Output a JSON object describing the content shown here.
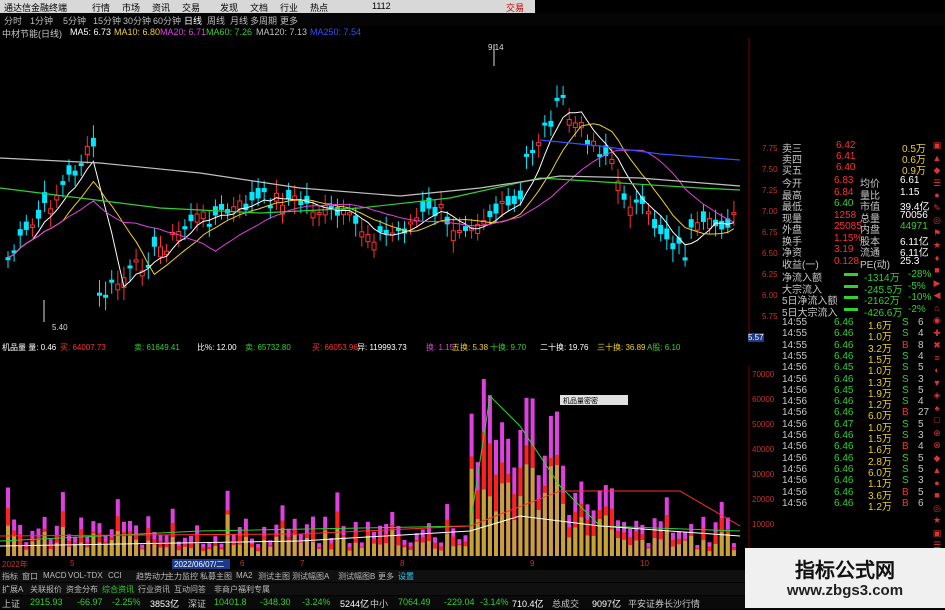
{
  "menubar": {
    "app_title": "通达信金融终端",
    "items": [
      "行情",
      "市场",
      "资讯",
      "交易",
      "发现",
      "文档",
      "行业",
      "热点",
      "1112"
    ],
    "trade_button": "交易"
  },
  "period_tabs": [
    "分时",
    "1分钟",
    "5分钟",
    "15分钟",
    "30分钟",
    "60分钟",
    "日线",
    "周线",
    "月线",
    "多周期",
    "更多"
  ],
  "active_period": "日线",
  "ma_legend": {
    "name": "中材节能(日线)",
    "items": [
      {
        "label": "MA5: 6.73",
        "color": "#ffffff"
      },
      {
        "label": "MA10: 6.80",
        "color": "#f0d020"
      },
      {
        "label": "MA20: 6.71",
        "color": "#e040e0"
      },
      {
        "label": "MA60: 7.26",
        "color": "#30d030"
      },
      {
        "label": "MA120: 7.13",
        "color": "#c0c0c0"
      },
      {
        "label": "MA250: 7.54",
        "color": "#3050ff"
      }
    ]
  },
  "price_axis": [
    "7.75",
    "7.50",
    "7.25",
    "7.00",
    "6.75",
    "6.50",
    "6.25",
    "6.00",
    "5.75",
    "5.57"
  ],
  "price_axis_highlight": "5.57",
  "annotations": {
    "high": "9.14",
    "low": "5.40"
  },
  "vol_legend": {
    "items": [
      {
        "label": "机品量 量: 0.46",
        "color": "#ffffff"
      },
      {
        "label": "买: 64007.73",
        "color": "#ff3030"
      },
      {
        "label": "卖: 61649.41",
        "color": "#30d030"
      },
      {
        "label": "比%: 12.00",
        "color": "#ffffff"
      },
      {
        "label": "卖: 65732.80",
        "color": "#30d030"
      },
      {
        "label": "买: 66053.96",
        "color": "#ff3030"
      },
      {
        "label": "异: 119993.73",
        "color": "#ffffff"
      },
      {
        "label": "换: 1.15",
        "color": "#e040e0"
      },
      {
        "label": "五换: 5.38",
        "color": "#f0d020"
      },
      {
        "label": "十换: 9.70",
        "color": "#30d030"
      },
      {
        "label": "二十换: 19.76",
        "color": "#ffffff"
      },
      {
        "label": "三十换: 36.89",
        "color": "#f0d020"
      },
      {
        "label": "A股: 6.10",
        "color": "#30d030"
      }
    ]
  },
  "vol_axis": [
    "70000",
    "60000",
    "50000",
    "40000",
    "30000",
    "20000",
    "10000"
  ],
  "popup_label": "机品量密密",
  "date_box": "2022/06/07/二",
  "year_labels": [
    "2022年",
    "5",
    "6",
    "7",
    "8",
    "9",
    "10"
  ],
  "quote_panel": [
    {
      "k": "卖三",
      "v": "6.42",
      "v2": "0.5万"
    },
    {
      "k": "卖四",
      "v": "6.41",
      "v2": "0.6万"
    },
    {
      "k": "买五",
      "v": "6.40",
      "v2": "0.9万"
    }
  ],
  "stats": [
    {
      "k": "今开",
      "v": "6.83",
      "k2": "均价",
      "v2": "6.61"
    },
    {
      "k": "最高",
      "v": "6.84",
      "k2": "量比",
      "v2": "1.15"
    },
    {
      "k": "最低",
      "v": "6.40",
      "k2": "市值",
      "v2": "39.4亿"
    },
    {
      "k": "现量",
      "v": "1258",
      "k2": "总量",
      "v2": "70056"
    },
    {
      "k": "外盘",
      "v": "25085",
      "k2": "内盘",
      "v2": "44971"
    },
    {
      "k": "换手",
      "v": "1.15%",
      "k2": "股本",
      "v2": "6.11亿"
    },
    {
      "k": "净资",
      "v": "3.19",
      "k2": "流通",
      "v2": "6.11亿"
    },
    {
      "k": "收益(一)",
      "v": "0.128",
      "k2": "PE(动)",
      "v2": "25.3"
    }
  ],
  "flows": [
    {
      "k": "净流入额",
      "v": "-1314万",
      "p": "-28%"
    },
    {
      "k": "大宗流入",
      "v": "-245.5万",
      "p": "-5%"
    },
    {
      "k": "5日净流入额",
      "v": "-2162万",
      "p": "-10%"
    },
    {
      "k": "5日大宗流入",
      "v": "-426.6万",
      "p": "-2%"
    }
  ],
  "ticks": [
    {
      "t": "14:55",
      "p": "6.46",
      "v": "1.6万",
      "s": "S",
      "n": "6"
    },
    {
      "t": "14:55",
      "p": "6.46",
      "v": "1.0万",
      "s": "S",
      "n": "4"
    },
    {
      "t": "14:55",
      "p": "6.46",
      "v": "3.2万",
      "s": "B",
      "n": "8"
    },
    {
      "t": "14:55",
      "p": "6.46",
      "v": "1.5万",
      "s": "S",
      "n": "4"
    },
    {
      "t": "14:56",
      "p": "6.45",
      "v": "1.0万",
      "s": "S",
      "n": "5"
    },
    {
      "t": "14:56",
      "p": "6.46",
      "v": "1.3万",
      "s": "S",
      "n": "3"
    },
    {
      "t": "14:56",
      "p": "6.45",
      "v": "1.9万",
      "s": "S",
      "n": "5"
    },
    {
      "t": "14:56",
      "p": "6.46",
      "v": "1.2万",
      "s": "S",
      "n": "4"
    },
    {
      "t": "14:56",
      "p": "6.46",
      "v": "6.0万",
      "s": "B",
      "n": "27"
    },
    {
      "t": "14:56",
      "p": "6.47",
      "v": "1.0万",
      "s": "S",
      "n": "5"
    },
    {
      "t": "14:56",
      "p": "6.46",
      "v": "1.5万",
      "s": "S",
      "n": "3"
    },
    {
      "t": "14:56",
      "p": "6.46",
      "v": "1.6万",
      "s": "B",
      "n": "4"
    },
    {
      "t": "14:56",
      "p": "6.46",
      "v": "2.8万",
      "s": "S",
      "n": "5"
    },
    {
      "t": "14:56",
      "p": "6.46",
      "v": "6.0万",
      "s": "S",
      "n": "5"
    },
    {
      "t": "14:56",
      "p": "6.46",
      "v": "1.1万",
      "s": "S",
      "n": "3"
    },
    {
      "t": "14:56",
      "p": "6.46",
      "v": "3.6万",
      "s": "B",
      "n": "5"
    },
    {
      "t": "14:56",
      "p": "6.46",
      "v": "1.2万",
      "s": "B",
      "n": "6"
    }
  ],
  "bottom_tabs": [
    "指标",
    "窗口",
    "MACD",
    "VOL-TDX",
    "CCI",
    "趋势动力",
    "主力监控",
    "私募主图",
    "MA2",
    "测试主图",
    "测试幅图A",
    "测试幅图B",
    "更多",
    "设置"
  ],
  "bottom_tabs2": [
    "扩展A",
    "关联报价",
    "资金分布",
    "综合资讯",
    "行业资讯",
    "互动问答",
    "非商户福利专属"
  ],
  "index_bar": [
    {
      "text": "上证",
      "color": "#c8c8c8"
    },
    {
      "text": "2915.93",
      "color": "#30d030"
    },
    {
      "text": "-66.97",
      "color": "#30d030"
    },
    {
      "text": "-2.25%",
      "color": "#30d030"
    },
    {
      "text": "3853亿",
      "color": "#ffffff"
    },
    {
      "text": "深证",
      "color": "#c8c8c8"
    },
    {
      "text": "10401.8",
      "color": "#30d030"
    },
    {
      "text": "-348.30",
      "color": "#30d030"
    },
    {
      "text": "-3.24%",
      "color": "#30d030"
    },
    {
      "text": "5244亿",
      "color": "#ffffff"
    },
    {
      "text": "中小",
      "color": "#c8c8c8"
    },
    {
      "text": "7064.49",
      "color": "#30d030"
    },
    {
      "text": "-229.04",
      "color": "#30d030"
    },
    {
      "text": "-3.14%",
      "color": "#30d030"
    },
    {
      "text": "710.4亿",
      "color": "#ffffff"
    },
    {
      "text": "总成交",
      "color": "#c8c8c8"
    },
    {
      "text": "9097亿",
      "color": "#ffffff"
    },
    {
      "text": "平安证券长沙行情",
      "color": "#c8c8c8"
    }
  ],
  "watermark": {
    "line1": "指标公式网",
    "line2": "www.zbgs3.com"
  },
  "colors": {
    "up": "#ff3030",
    "down": "#00e8ff",
    "bg": "#000000",
    "grid": "#7a0000"
  }
}
